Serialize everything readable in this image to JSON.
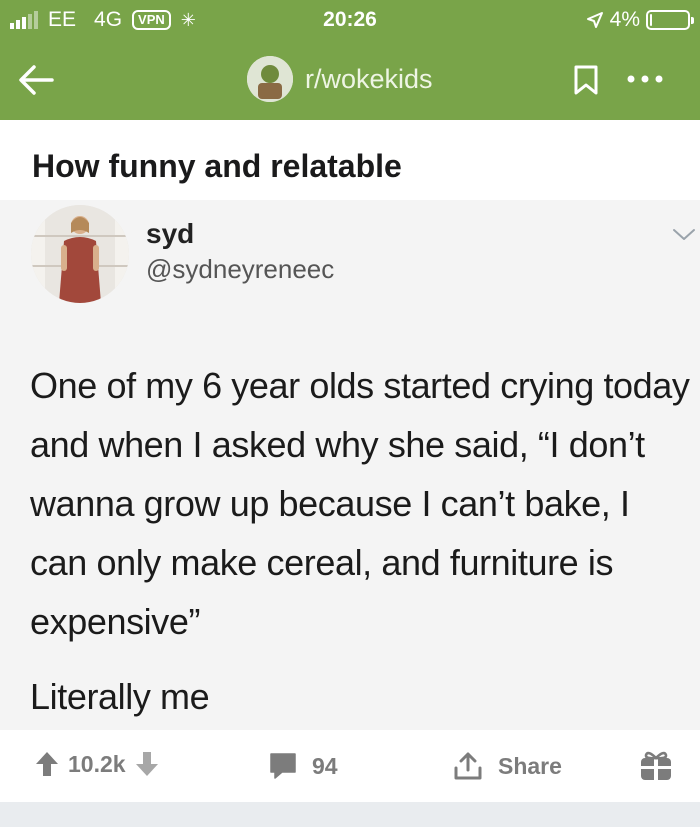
{
  "status_bar": {
    "carrier": "EE",
    "network": "4G",
    "vpn": "VPN",
    "time": "20:26",
    "battery": "4%",
    "battery_level": 0.04
  },
  "nav": {
    "subreddit": "r/wokekids"
  },
  "post": {
    "title": "How funny and relatable"
  },
  "tweet": {
    "name": "syd",
    "handle": "@sydneyreneec",
    "text": "One of my 6 year olds started crying today and when I asked why she said, “I don’t wanna grow up because I can’t bake, I can only make cereal, and furniture is expensive”",
    "caption": "Literally me"
  },
  "actions": {
    "score": "10.2k",
    "comments": "94",
    "share": "Share"
  },
  "colors": {
    "header": "#79a449",
    "icon_gray": "#7c7c7c"
  }
}
